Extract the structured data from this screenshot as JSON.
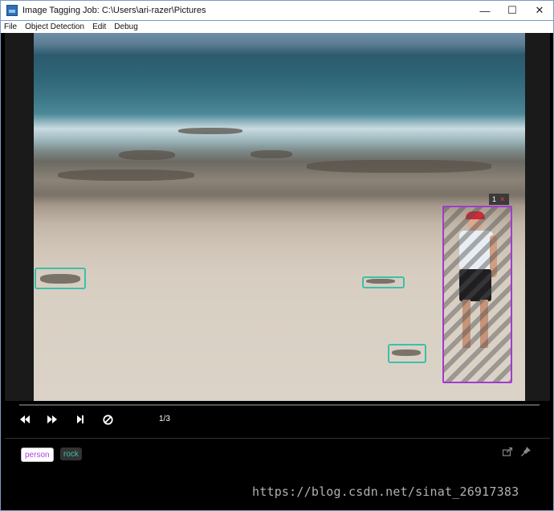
{
  "window": {
    "title": "Image Tagging Job: C:\\Users\\ari-razer\\Pictures",
    "minimize": "—",
    "maximize": "☐",
    "close": "✕"
  },
  "menu": {
    "items": [
      {
        "label": "File"
      },
      {
        "label": "Object Detection"
      },
      {
        "label": "Edit"
      },
      {
        "label": "Debug"
      }
    ]
  },
  "canvas": {
    "selected_box": {
      "index": "1",
      "close": "✕"
    },
    "regions": [
      {
        "tag": "person"
      },
      {
        "tag": "rock"
      },
      {
        "tag": "rock"
      },
      {
        "tag": "rock"
      }
    ]
  },
  "player": {
    "prev_icon": "rewind-icon",
    "next_icon": "fast-forward-icon",
    "skip_icon": "skip-end-icon",
    "clear_icon": "clear-icon",
    "frame_counter": "1/3"
  },
  "tags": {
    "items": [
      {
        "label": "person",
        "color": "#b23fe0"
      },
      {
        "label": "rock",
        "color": "#3dbfa8"
      }
    ]
  },
  "watermark": "https://blog.csdn.net/sinat_26917383",
  "colors": {
    "person_box": "#a23ad1",
    "rock_box": "#3dbfa8"
  }
}
